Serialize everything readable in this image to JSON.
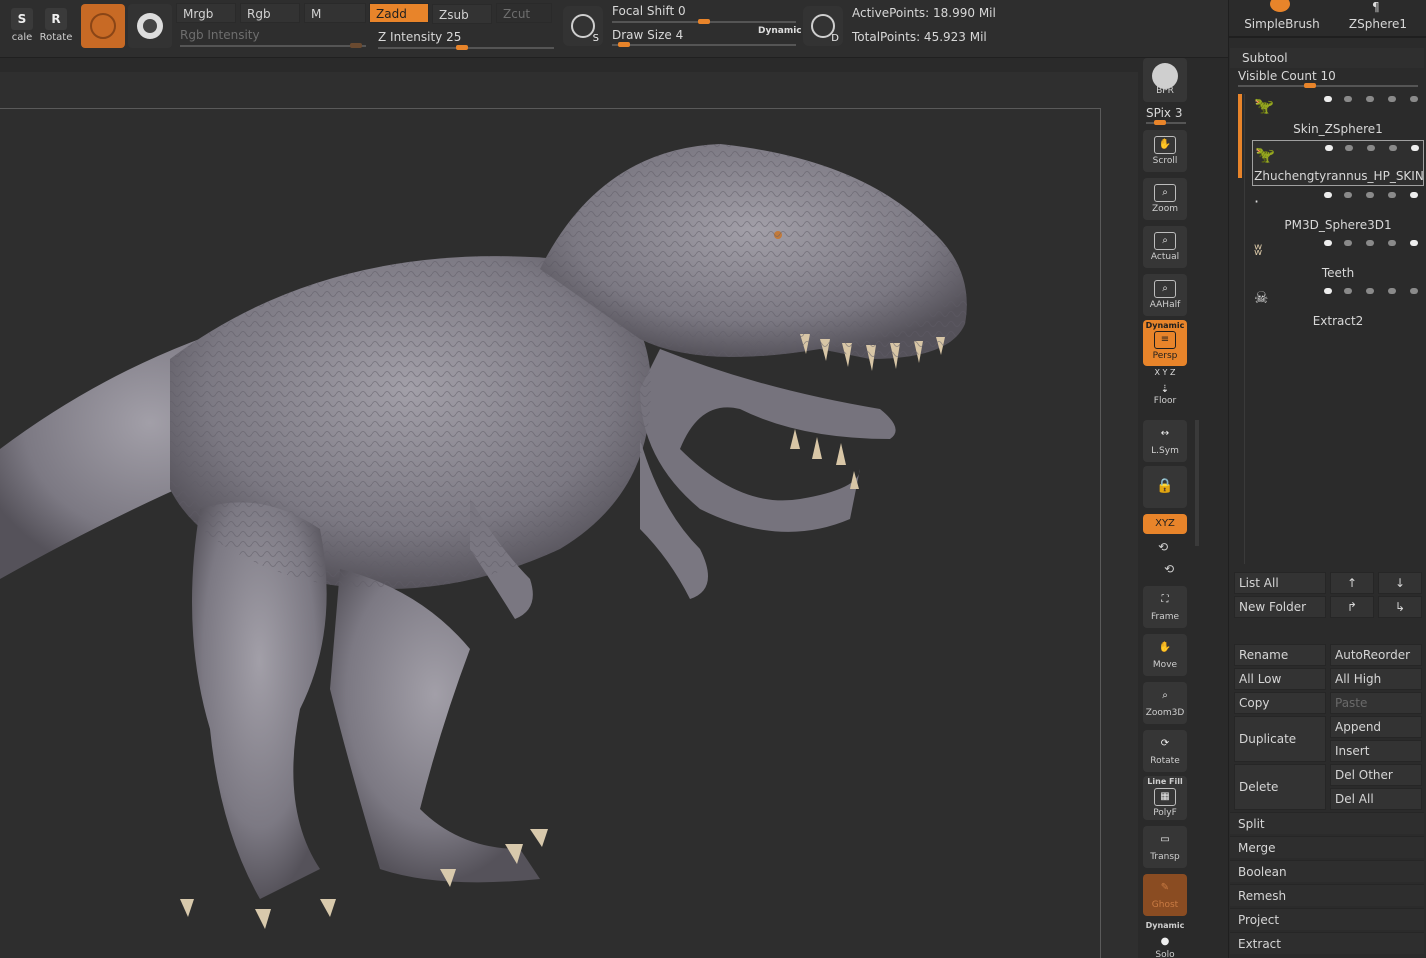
{
  "toolbar": {
    "scale_label": "cale",
    "rotate_label": "Rotate",
    "modes_row1": [
      "Mrgb",
      "Rgb",
      "M",
      "Zadd",
      "Zsub",
      "Zcut"
    ],
    "rgb_intensity_label": "Rgb Intensity",
    "z_intensity": {
      "label": "Z Intensity",
      "value": "25",
      "level": 0.25
    },
    "focal_shift": {
      "label": "Focal Shift",
      "value": "0",
      "level": 0.5
    },
    "draw_size": {
      "label": "Draw Size",
      "value": "4",
      "level": 0.04
    },
    "dynamic_label": "Dynamic",
    "s_label": "S",
    "d_label": "D",
    "active_points": "ActivePoints: 18.990 Mil",
    "total_points": "TotalPoints: 45.923 Mil"
  },
  "shelf": {
    "bpr": "BPR",
    "spix_label": "SPix",
    "spix_value": "3",
    "scroll": "Scroll",
    "zoom": "Zoom",
    "actual": "Actual",
    "aahalf": "AAHalf",
    "persp_top": "Dynamic",
    "persp": "Persp",
    "xyz_small": "X Y Z",
    "floor": "Floor",
    "lsym": "L.Sym",
    "xyz": "XYZ",
    "frame": "Frame",
    "move": "Move",
    "zoom3d": "Zoom3D",
    "rotate": "Rotate",
    "polyf_top": "Line Fill",
    "polyf": "PolyF",
    "transp": "Transp",
    "ghost": "Ghost",
    "solo_top": "Dynamic",
    "solo": "Solo"
  },
  "panel": {
    "tools": [
      "SimpleBrush",
      "ZSphere1"
    ],
    "subtool_header": "Subtool",
    "visible_count_label": "Visible Count",
    "visible_count": "10",
    "subtools": [
      "Skin_ZSphere1",
      "Zhuchengtyrannus_HP_SKIN",
      "PM3D_Sphere3D1",
      "Teeth",
      "Extract2"
    ],
    "list_all": "List All",
    "new_folder": "New Folder",
    "rename": "Rename",
    "auto_reorder": "AutoReorder",
    "all_low": "All Low",
    "all_high": "All High",
    "copy": "Copy",
    "paste": "Paste",
    "duplicate": "Duplicate",
    "append": "Append",
    "insert": "Insert",
    "delete": "Delete",
    "del_other": "Del Other",
    "del_all": "Del All",
    "sections": [
      "Split",
      "Merge",
      "Boolean",
      "Remesh",
      "Project",
      "Extract"
    ]
  },
  "colors": {
    "accent": "#e8842a",
    "model": "#8a8690"
  }
}
